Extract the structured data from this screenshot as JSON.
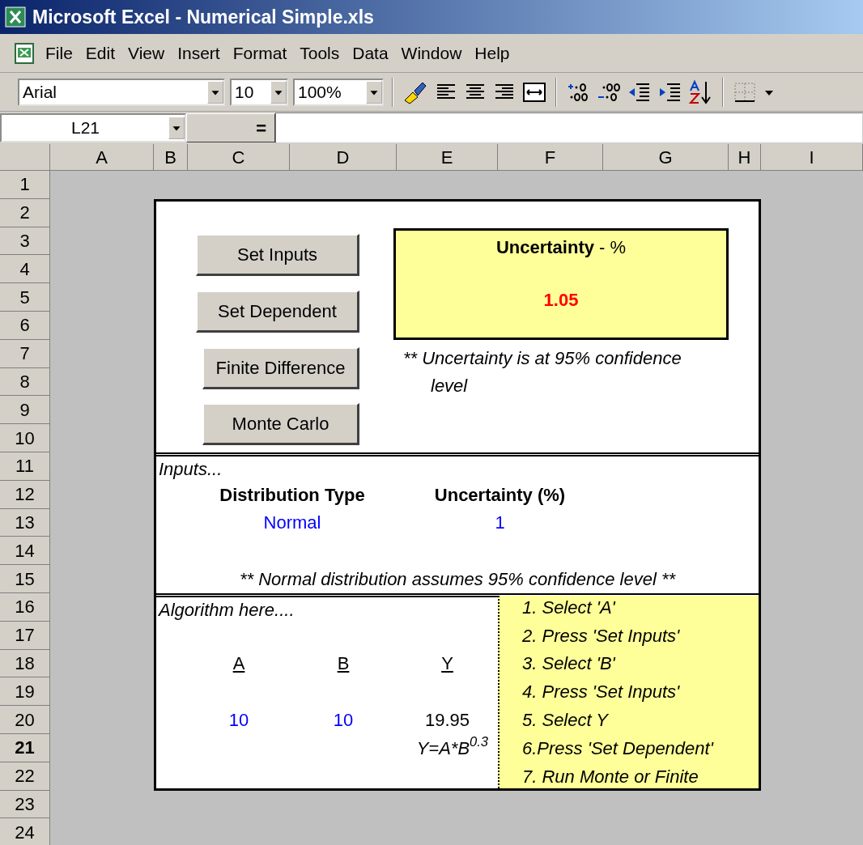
{
  "window": {
    "title": "Microsoft Excel - Numerical Simple.xls"
  },
  "menu": [
    "File",
    "Edit",
    "View",
    "Insert",
    "Format",
    "Tools",
    "Data",
    "Window",
    "Help"
  ],
  "toolbar": {
    "font": "Arial",
    "size": "10",
    "zoom": "100%"
  },
  "formula_bar": {
    "name_box": "L21",
    "equals": "="
  },
  "columns": [
    "A",
    "B",
    "C",
    "D",
    "E",
    "F",
    "G",
    "H",
    "I"
  ],
  "rows": [
    {
      "label": "1",
      "selected": false
    },
    {
      "label": "2",
      "selected": false
    },
    {
      "label": "3",
      "selected": false
    },
    {
      "label": "4",
      "selected": false
    },
    {
      "label": "5",
      "selected": false
    },
    {
      "label": "6",
      "selected": false
    },
    {
      "label": "7",
      "selected": false
    },
    {
      "label": "8",
      "selected": false
    },
    {
      "label": "9",
      "selected": false
    },
    {
      "label": "10",
      "selected": false
    },
    {
      "label": "11",
      "selected": false
    },
    {
      "label": "12",
      "selected": false
    },
    {
      "label": "13",
      "selected": false
    },
    {
      "label": "14",
      "selected": false
    },
    {
      "label": "15",
      "selected": false
    },
    {
      "label": "16",
      "selected": false
    },
    {
      "label": "17",
      "selected": false
    },
    {
      "label": "18",
      "selected": false
    },
    {
      "label": "19",
      "selected": false
    },
    {
      "label": "20",
      "selected": false
    },
    {
      "label": "21",
      "selected": true
    },
    {
      "label": "22",
      "selected": false
    },
    {
      "label": "23",
      "selected": false
    },
    {
      "label": "24",
      "selected": false
    }
  ],
  "buttons": [
    "Set Inputs",
    "Set Dependent",
    "Finite Difference",
    "Monte Carlo"
  ],
  "result": {
    "title": "**Uncertainty** - %",
    "value": "1.05",
    "note": "** Uncertainty is at 95% confidence level"
  },
  "inputs": {
    "label": "Inputs...",
    "columns": [
      {
        "header": "Distribution Type",
        "value": "Normal"
      },
      {
        "header": "Uncertainty (%)",
        "value": "1"
      }
    ],
    "note": "** Normal distribution assumes 95% confidence level **"
  },
  "algorithm": {
    "label": "Algorithm here....",
    "variables": [
      {
        "name": "A",
        "value": "10",
        "kind": "input"
      },
      {
        "name": "B",
        "value": "10",
        "kind": "input"
      },
      {
        "name": "Y",
        "value": "19.95",
        "kind": "output"
      }
    ],
    "formula": "Y=A*B$^{0.3}$"
  },
  "steps": [
    "1. Select 'A'",
    "2. Press 'Set Inputs'",
    "3. Select 'B'",
    "4. Press 'Set Inputs'",
    "5. Select Y",
    "6.Press 'Set Dependent'",
    "7. Run Monte or Finite"
  ]
}
